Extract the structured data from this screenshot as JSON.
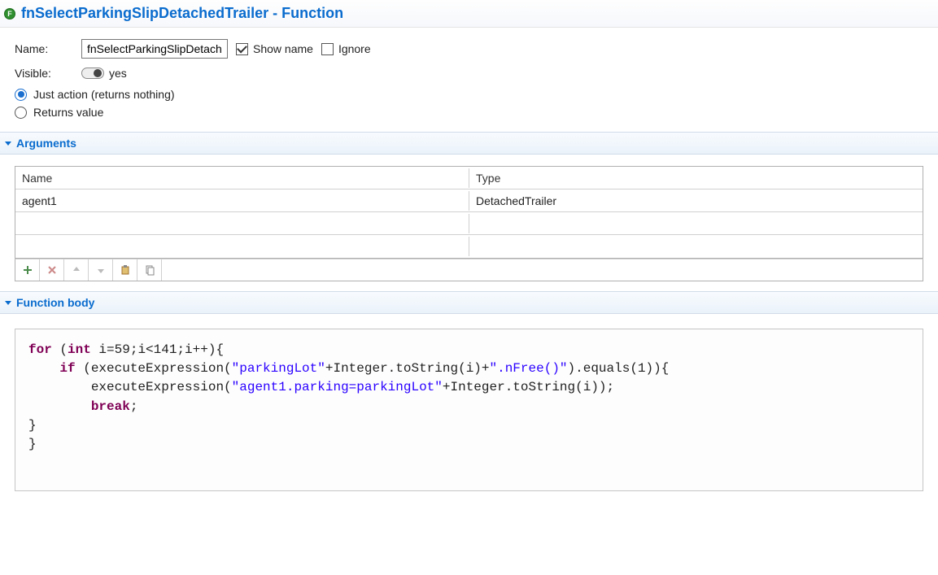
{
  "header": {
    "title": "fnSelectParkingSlipDetachedTrailer - Function"
  },
  "properties": {
    "name_label": "Name:",
    "name_value": "fnSelectParkingSlipDetachedTrailer",
    "show_name_label": "Show name",
    "show_name_checked": true,
    "ignore_label": "Ignore",
    "ignore_checked": false,
    "visible_label": "Visible:",
    "visible_text": "yes",
    "radio_just_action": "Just action (returns nothing)",
    "radio_returns_value": "Returns value"
  },
  "sections": {
    "arguments_title": "Arguments",
    "function_body_title": "Function body"
  },
  "arguments_table": {
    "headers": {
      "name": "Name",
      "type": "Type"
    },
    "rows": [
      {
        "name": "agent1",
        "type": "DetachedTrailer"
      }
    ]
  },
  "code": {
    "tokens": [
      {
        "t": "kw",
        "v": "for"
      },
      {
        "t": "p",
        "v": " ("
      },
      {
        "t": "kw",
        "v": "int"
      },
      {
        "t": "p",
        "v": " i=59;i<141;i++){\n    "
      },
      {
        "t": "kw",
        "v": "if"
      },
      {
        "t": "p",
        "v": " (executeExpression("
      },
      {
        "t": "str",
        "v": "\"parkingLot\""
      },
      {
        "t": "p",
        "v": "+Integer.toString(i)+"
      },
      {
        "t": "str",
        "v": "\".nFree()\""
      },
      {
        "t": "p",
        "v": ").equals(1)){\n        executeExpression("
      },
      {
        "t": "str",
        "v": "\"agent1.parking=parkingLot\""
      },
      {
        "t": "p",
        "v": "+Integer.toString(i));\n        "
      },
      {
        "t": "kw",
        "v": "break"
      },
      {
        "t": "p",
        "v": ";\n}\n}\n"
      }
    ]
  }
}
